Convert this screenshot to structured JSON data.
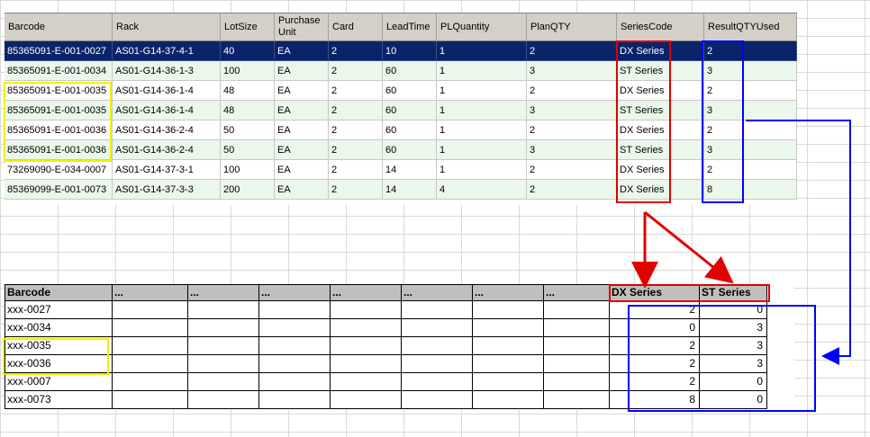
{
  "top_grid": {
    "columns": [
      "Barcode",
      "Rack",
      "LotSize",
      "Purchase Unit",
      "Card",
      "LeadTime",
      "PLQuantity",
      "PlanQTY",
      "SeriesCode",
      "ResultQTYUsed"
    ],
    "rows": [
      [
        "85365091-E-001-0027",
        "AS01-G14-37-4-1",
        "40",
        "EA",
        "2",
        "10",
        "1",
        "2",
        "DX Series",
        "2"
      ],
      [
        "85365091-E-001-0034",
        "AS01-G14-36-1-3",
        "100",
        "EA",
        "2",
        "60",
        "1",
        "3",
        "ST Series",
        "3"
      ],
      [
        "85365091-E-001-0035",
        "AS01-G14-36-1-4",
        "48",
        "EA",
        "2",
        "60",
        "1",
        "2",
        "DX Series",
        "2"
      ],
      [
        "85365091-E-001-0035",
        "AS01-G14-36-1-4",
        "48",
        "EA",
        "2",
        "60",
        "1",
        "3",
        "ST Series",
        "3"
      ],
      [
        "85365091-E-001-0036",
        "AS01-G14-36-2-4",
        "50",
        "EA",
        "2",
        "60",
        "1",
        "2",
        "DX Series",
        "2"
      ],
      [
        "85365091-E-001-0036",
        "AS01-G14-36-2-4",
        "50",
        "EA",
        "2",
        "60",
        "1",
        "3",
        "ST Series",
        "3"
      ],
      [
        "73269090-E-034-0007",
        "AS01-G14-37-3-1",
        "100",
        "EA",
        "2",
        "14",
        "1",
        "2",
        "DX Series",
        "2"
      ],
      [
        "85369099-E-001-0073",
        "AS01-G14-37-3-3",
        "200",
        "EA",
        "2",
        "14",
        "4",
        "2",
        "DX Series",
        "8"
      ]
    ],
    "selected_row": 0
  },
  "bottom_grid": {
    "columns": [
      "Barcode",
      "...",
      "...",
      "...",
      "...",
      "...",
      "...",
      "...",
      "DX Series",
      "ST Series"
    ],
    "rows": [
      [
        "xxx-0027",
        "",
        "",
        "",
        "",
        "",
        "",
        "",
        "2",
        "0"
      ],
      [
        "xxx-0034",
        "",
        "",
        "",
        "",
        "",
        "",
        "",
        "0",
        "3"
      ],
      [
        "xxx-0035",
        "",
        "",
        "",
        "",
        "",
        "",
        "",
        "2",
        "3"
      ],
      [
        "xxx-0036",
        "",
        "",
        "",
        "",
        "",
        "",
        "",
        "2",
        "3"
      ],
      [
        "xxx-0007",
        "",
        "",
        "",
        "",
        "",
        "",
        "",
        "2",
        "0"
      ],
      [
        "xxx-0073",
        "",
        "",
        "",
        "",
        "",
        "",
        "",
        "8",
        "0"
      ]
    ]
  },
  "colors": {
    "selection": "#0a246a",
    "alt_row": "#eaf7ea",
    "header": "#d4d0c8",
    "annotation_red": "#e00000",
    "annotation_blue": "#0000ff",
    "annotation_yellow": "#f0f000"
  }
}
